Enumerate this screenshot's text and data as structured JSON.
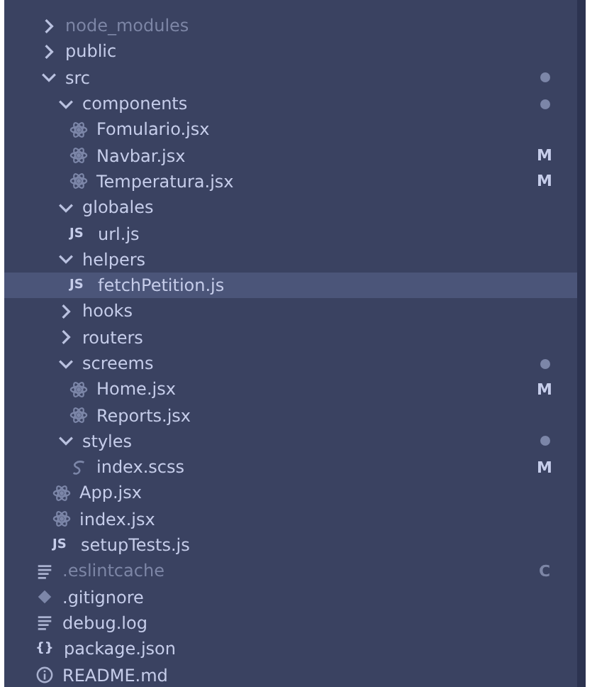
{
  "explorer": {
    "items": [
      {
        "name": "node_modules",
        "kind": "folder",
        "expanded": false,
        "selected": false,
        "dimmed": true
      },
      {
        "name": "public",
        "kind": "folder",
        "expanded": false,
        "selected": false,
        "dimmed": false
      },
      {
        "name": "src",
        "kind": "folder",
        "expanded": true,
        "selected": false,
        "dimmed": false,
        "dot": true,
        "children": [
          {
            "name": "components",
            "kind": "folder",
            "expanded": true,
            "selected": false,
            "dimmed": false,
            "dot": true,
            "children": [
              {
                "name": "Fomulario.jsx",
                "kind": "react",
                "selected": false,
                "dimmed": false
              },
              {
                "name": "Navbar.jsx",
                "kind": "react",
                "selected": false,
                "dimmed": false,
                "badge": "M"
              },
              {
                "name": "Temperatura.jsx",
                "kind": "react",
                "selected": false,
                "dimmed": false,
                "badge": "M"
              }
            ]
          },
          {
            "name": "globales",
            "kind": "folder",
            "expanded": true,
            "selected": false,
            "dimmed": false,
            "children": [
              {
                "name": "url.js",
                "kind": "glyph",
                "icon": "JS",
                "selected": false,
                "dimmed": false
              }
            ]
          },
          {
            "name": "helpers",
            "kind": "folder",
            "expanded": true,
            "selected": false,
            "dimmed": false,
            "children": [
              {
                "name": "fetchPetition.js",
                "kind": "glyph",
                "icon": "JS",
                "selected": true,
                "dimmed": false
              }
            ]
          },
          {
            "name": "hooks",
            "kind": "folder",
            "expanded": false,
            "selected": false,
            "dimmed": false
          },
          {
            "name": "routers",
            "kind": "folder",
            "expanded": false,
            "selected": false,
            "dimmed": false
          },
          {
            "name": "screems",
            "kind": "folder",
            "expanded": true,
            "selected": false,
            "dimmed": false,
            "dot": true,
            "children": [
              {
                "name": "Home.jsx",
                "kind": "react",
                "selected": false,
                "dimmed": false,
                "badge": "M"
              },
              {
                "name": "Reports.jsx",
                "kind": "react",
                "selected": false,
                "dimmed": false
              }
            ]
          },
          {
            "name": "styles",
            "kind": "folder",
            "expanded": true,
            "selected": false,
            "dimmed": false,
            "dot": true,
            "children": [
              {
                "name": "index.scss",
                "kind": "sass",
                "selected": false,
                "dimmed": false,
                "badge": "M"
              }
            ]
          },
          {
            "name": "App.jsx",
            "kind": "react",
            "selected": false,
            "dimmed": false
          },
          {
            "name": "index.jsx",
            "kind": "react",
            "selected": false,
            "dimmed": false
          },
          {
            "name": "setupTests.js",
            "kind": "glyph",
            "icon": "JS",
            "selected": false,
            "dimmed": false
          }
        ]
      },
      {
        "name": ".eslintcache",
        "kind": "lines",
        "selected": false,
        "dimmed": true,
        "badge": "C"
      },
      {
        "name": ".gitignore",
        "kind": "diamond",
        "selected": false,
        "dimmed": false
      },
      {
        "name": "debug.log",
        "kind": "lines",
        "selected": false,
        "dimmed": false
      },
      {
        "name": "package.json",
        "kind": "glyph",
        "icon": "{}",
        "selected": false,
        "dimmed": false
      },
      {
        "name": "README.md",
        "kind": "info",
        "selected": false,
        "dimmed": false
      }
    ]
  }
}
